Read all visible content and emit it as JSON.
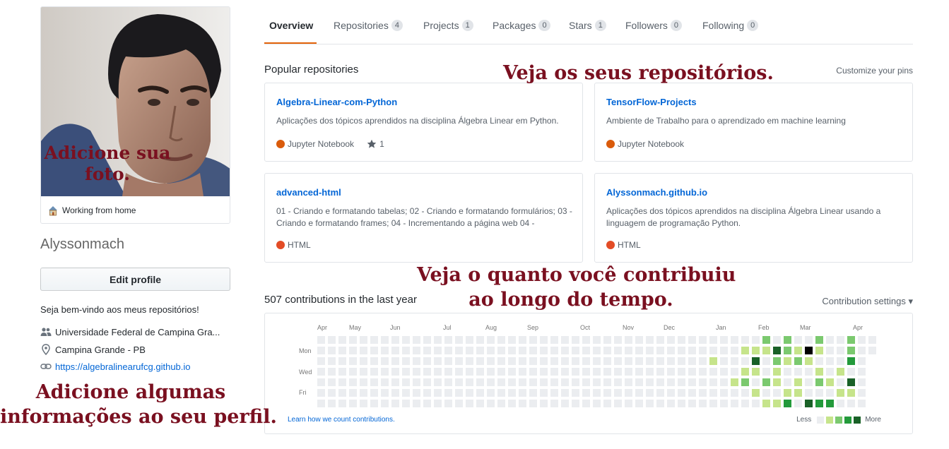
{
  "profile": {
    "status_text": "Working from home",
    "username": "Alyssonmach",
    "edit_label": "Edit profile",
    "bio": "Seja bem-vindo aos meus repositórios!",
    "org": "Universidade Federal de Campina Gra...",
    "location": "Campina Grande - PB",
    "website": "https://algebralinearufcg.github.io",
    "icons": [
      "house-emoji-icon",
      "people-icon",
      "location-icon",
      "link-icon"
    ]
  },
  "tabs": [
    {
      "label": "Overview",
      "count": null,
      "active": true
    },
    {
      "label": "Repositories",
      "count": "4"
    },
    {
      "label": "Projects",
      "count": "1"
    },
    {
      "label": "Packages",
      "count": "0"
    },
    {
      "label": "Stars",
      "count": "1"
    },
    {
      "label": "Followers",
      "count": "0"
    },
    {
      "label": "Following",
      "count": "0"
    }
  ],
  "pinned": {
    "title": "Popular repositories",
    "customize": "Customize your pins",
    "repos": [
      {
        "name": "Algebra-Linear-com-Python",
        "desc": "Aplicações dos tópicos aprendidos na disciplina Álgebra Linear em Python.",
        "lang": "Jupyter Notebook",
        "lang_color": "#DA5B0B",
        "stars": "1"
      },
      {
        "name": "TensorFlow-Projects",
        "desc": "Ambiente de Trabalho para o aprendizado em machine learning",
        "lang": "Jupyter Notebook",
        "lang_color": "#DA5B0B"
      },
      {
        "name": "advanced-html",
        "desc": "01 - Criando e formatando tabelas; 02 - Criando e formatando formulários; 03 - Criando e formatando frames; 04 - Incrementando a página web 04 -",
        "lang": "HTML",
        "lang_color": "#e34c26"
      },
      {
        "name": "Alyssonmach.github.io",
        "desc": "Aplicações dos tópicos aprendidos na disciplina Álgebra Linear usando a linguagem de programação Python.",
        "lang": "HTML",
        "lang_color": "#e34c26"
      }
    ]
  },
  "contributions": {
    "title": "507 contributions in the last year",
    "settings": "Contribution settings",
    "months": [
      "Apr",
      "May",
      "Jun",
      "Jul",
      "Aug",
      "Sep",
      "Oct",
      "Nov",
      "Dec",
      "Jan",
      "Feb",
      "Mar",
      "Apr"
    ],
    "weekdays": [
      "Mon",
      "Wed",
      "Fri"
    ],
    "learn": "Learn how we count contributions.",
    "less": "Less",
    "more": "More",
    "colors": [
      "#ebedf0",
      "#c6e48b",
      "#7bc96f",
      "#239a3b",
      "#196127"
    ]
  },
  "annotations": {
    "photo": [
      "Adicione sua",
      "foto."
    ],
    "repos": "Veja os seus repositórios.",
    "contrib": [
      "Veja o quanto você contribuiu",
      "ao longo do tempo."
    ],
    "info": [
      "Adicione algumas",
      "informações ao seu perfil."
    ]
  }
}
